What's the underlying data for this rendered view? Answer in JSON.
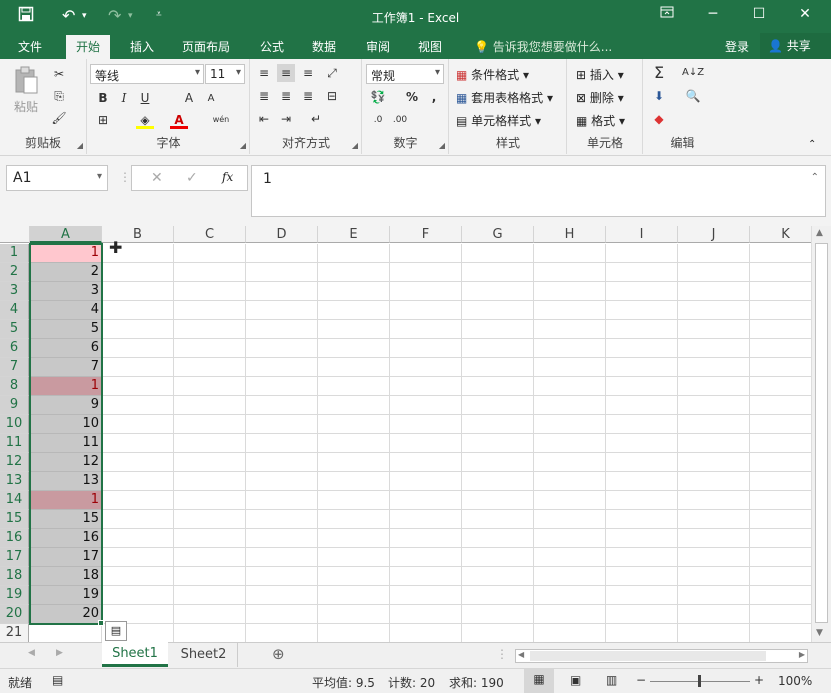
{
  "title": "工作簿1 - Excel",
  "qat": {
    "save": "save-icon",
    "undo": "undo-icon",
    "redo": "redo-icon"
  },
  "window_controls": [
    "ribbon-display-icon",
    "minimize-icon",
    "maximize-icon",
    "close-icon"
  ],
  "tabs": [
    "文件",
    "开始",
    "插入",
    "页面布局",
    "公式",
    "数据",
    "审阅",
    "视图"
  ],
  "active_tab": "开始",
  "tell_me": "告诉我您想要做什么...",
  "login": "登录",
  "share": "共享",
  "ribbon": {
    "clipboard": {
      "label": "剪贴板",
      "paste": "粘贴"
    },
    "font": {
      "label": "字体",
      "name": "等线",
      "size": "11",
      "bold": "B",
      "italic": "I",
      "underline": "U",
      "grow": "A",
      "shrink": "A",
      "phonetic": "wén"
    },
    "alignment": {
      "label": "对齐方式"
    },
    "number": {
      "label": "数字",
      "format": "常规",
      "percent": "%",
      "comma": ","
    },
    "styles": {
      "label": "样式",
      "conditional": "条件格式",
      "table": "套用表格格式",
      "cell": "单元格样式"
    },
    "cells": {
      "label": "单元格",
      "insert": "插入",
      "delete": "删除",
      "format": "格式"
    },
    "editing": {
      "label": "编辑"
    }
  },
  "formula_bar": {
    "name_box": "A1",
    "fx": "fx",
    "value": "1"
  },
  "columns": [
    "A",
    "B",
    "C",
    "D",
    "E",
    "F",
    "G",
    "H",
    "I",
    "J",
    "K"
  ],
  "rows": [
    "1",
    "2",
    "3",
    "4",
    "5",
    "6",
    "7",
    "8",
    "9",
    "10",
    "11",
    "12",
    "13",
    "14",
    "15",
    "16",
    "17",
    "18",
    "19",
    "20",
    "21"
  ],
  "col_a_values": [
    "1",
    "2",
    "3",
    "4",
    "5",
    "6",
    "7",
    "1",
    "9",
    "10",
    "11",
    "12",
    "13",
    "1",
    "15",
    "16",
    "17",
    "18",
    "19",
    "20",
    ""
  ],
  "duplicate_rows": [
    1,
    8,
    14
  ],
  "colors": {
    "excel_green": "#217346",
    "dup_fill": "#ffc7ce",
    "dup_text": "#9c0006"
  },
  "sheets": [
    "Sheet1",
    "Sheet2"
  ],
  "active_sheet": "Sheet1",
  "status": {
    "mode": "就绪",
    "average": "平均值: 9.5",
    "count": "计数: 20",
    "sum": "求和: 190",
    "zoom": "100%"
  }
}
